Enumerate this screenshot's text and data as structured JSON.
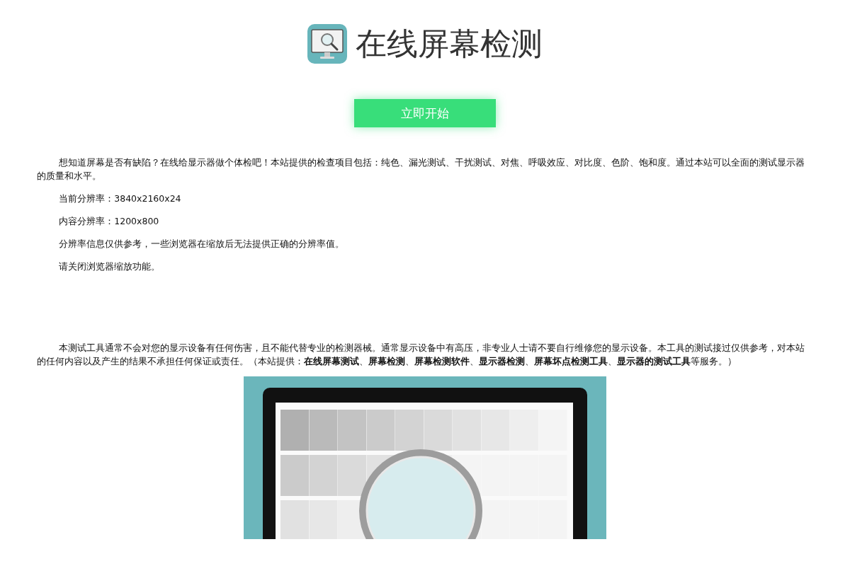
{
  "header": {
    "title": "在线屏幕检测"
  },
  "start_button": "立即开始",
  "info_paragraphs": [
    "想知道屏幕是否有缺陷？在线给显示器做个体检吧！本站提供的检查项目包括：纯色、漏光测试、干扰测试、对焦、呼吸效应、对比度、色阶、饱和度。通过本站可以全面的测试显示器的质量和水平。",
    "当前分辨率：3840x2160x24",
    "内容分辨率：1200x800",
    "分辨率信息仅供参考，一些浏览器在缩放后无法提供正确的分辨率值。",
    "请关闭浏览器缩放功能。"
  ],
  "disclaimer": "本测试工具通常不会对您的显示设备有任何伤害，且不能代替专业的检测器械。通常显示设备中有高压，非专业人士请不要自行维修您的显示设备。本工具的测试接过仅供参考，对本站的任何内容以及产生的结果不承担任何保证或责任。（本站提供：**在线屏幕测试**、**屏幕检测**、**屏幕检测软件**、**显示器检测**、**屏幕坏点检测工具**、**显示器的测试工具**等服务。）"
}
